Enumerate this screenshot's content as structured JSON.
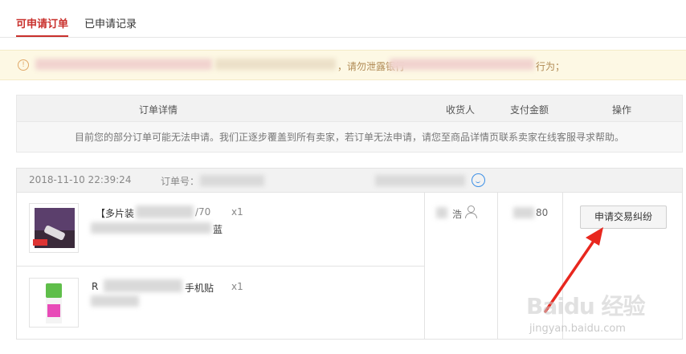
{
  "tabs": [
    {
      "label": "可申请订单",
      "active": true
    },
    {
      "label": "已申请记录",
      "active": false
    }
  ],
  "notice": {
    "visible_text_1": "，请勿泄露银行",
    "visible_text_2": "行为；",
    "accent_color": "#fdf8e4"
  },
  "table_header": {
    "order_details": "订单详情",
    "receiver": "收货人",
    "payment": "支付金额",
    "action": "操作"
  },
  "tip": "目前您的部分订单可能无法申请。我们正逐步覆盖到所有卖家，若订单无法申请，请您至商品详情页联系卖家在线客服寻求帮助。",
  "order": {
    "datetime": "2018-11-10 22:39:24",
    "order_no_label": "订单号：",
    "items": [
      {
        "name_prefix": "【多片装",
        "name_suffix": "/70",
        "name_line2": "蓝",
        "qty": "x1"
      },
      {
        "name_prefix": "R",
        "name_suffix": "手机贴",
        "qty": "x1"
      }
    ],
    "receiver_name": "浩",
    "amount": "80",
    "dispute_button": "申请交易纠纷"
  },
  "watermark": {
    "main": "Baidu 经验",
    "sub": "jingyan.baidu.com"
  }
}
